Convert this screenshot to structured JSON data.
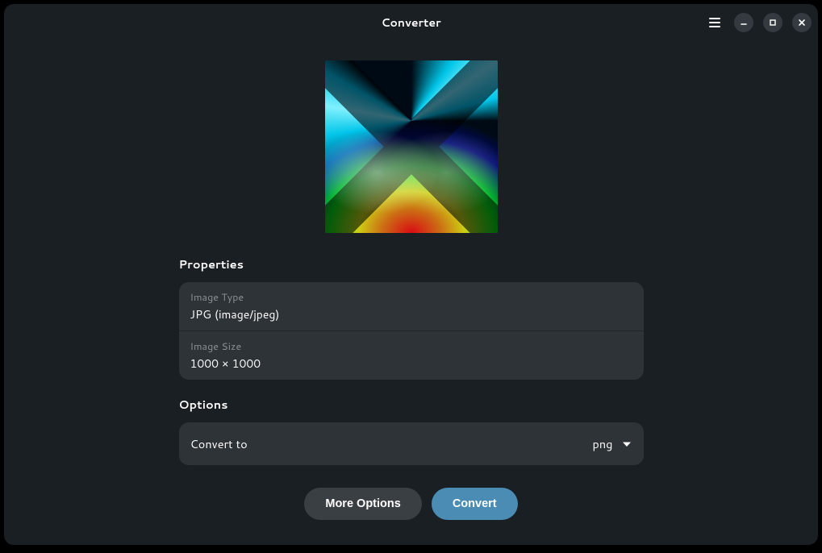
{
  "header": {
    "title": "Converter"
  },
  "properties": {
    "section_title": "Properties",
    "image_type": {
      "label": "Image Type",
      "value": "JPG (image/jpeg)"
    },
    "image_size": {
      "label": "Image Size",
      "value": "1000 × 1000"
    }
  },
  "options": {
    "section_title": "Options",
    "convert_to": {
      "label": "Convert to",
      "value": "png"
    }
  },
  "actions": {
    "more_options": "More Options",
    "convert": "Convert"
  }
}
